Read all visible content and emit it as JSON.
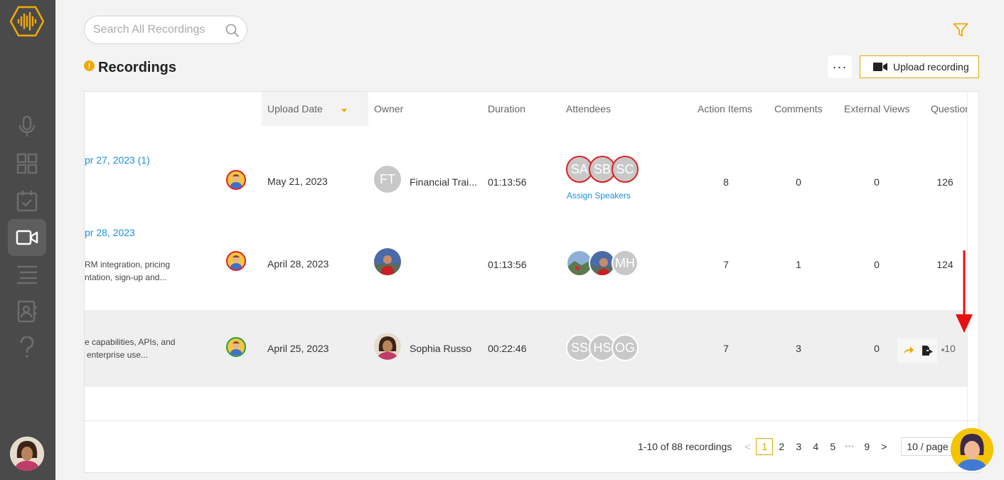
{
  "search": {
    "placeholder": "Search All Recordings"
  },
  "page": {
    "title": "Recordings",
    "warn_glyph": "!",
    "more_glyph": "···",
    "upload_label": "Upload recording"
  },
  "columns": {
    "upload_date": "Upload Date",
    "owner": "Owner",
    "duration": "Duration",
    "attendees": "Attendees",
    "action_items": "Action Items",
    "comments": "Comments",
    "external_views": "External Views",
    "questions": "Questions"
  },
  "rows": [
    {
      "title": "pr 27, 2023 (1)",
      "desc_line1": "",
      "desc_line2": "",
      "upload_date": "May 21, 2023",
      "owner_initials": "FT",
      "owner_name": "Financial Trai...",
      "duration": "01:13:56",
      "attendees": [
        "SA",
        "SB",
        "SC"
      ],
      "assign_speakers": "Assign Speakers",
      "action_items": "8",
      "comments": "0",
      "external_views": "0",
      "questions": "126"
    },
    {
      "title": "pr 28, 2023",
      "desc_line1": "RM integration, pricing",
      "desc_line2": "ntation, sign-up and...",
      "upload_date": "April 28, 2023",
      "owner_initials": "",
      "owner_name": "",
      "duration": "01:13:56",
      "attendees": [
        "",
        "",
        "MH"
      ],
      "action_items": "7",
      "comments": "1",
      "external_views": "0",
      "questions": "124"
    },
    {
      "title": "",
      "desc_line1": "e capabilities, APIs, and",
      "desc_line2": "enterprise use...",
      "upload_date": "April 25, 2023",
      "owner_initials": "",
      "owner_name": "Sophia Russo",
      "duration": "00:22:46",
      "attendees": [
        "SS",
        "HS",
        "OG"
      ],
      "action_items": "7",
      "comments": "3",
      "external_views": "0",
      "questions": "10"
    }
  ],
  "pagination": {
    "summary": "1-10 of 88 recordings",
    "prev": "<",
    "pages": [
      "1",
      "2",
      "3",
      "4",
      "5"
    ],
    "ellipsis": "•••",
    "last_page": "9",
    "next": ">",
    "page_size": "10 / page"
  },
  "colors": {
    "accent": "#f2a900",
    "link": "#1a8fe0",
    "sidebar": "#4a4a4a",
    "annotation": "#e81010"
  },
  "icons": [
    "logo-icon",
    "microphone-icon",
    "grid-icon",
    "calendar-check-icon",
    "video-icon",
    "list-icon",
    "contacts-icon",
    "help-icon",
    "search-icon",
    "filter-icon",
    "share-icon",
    "export-icon"
  ]
}
